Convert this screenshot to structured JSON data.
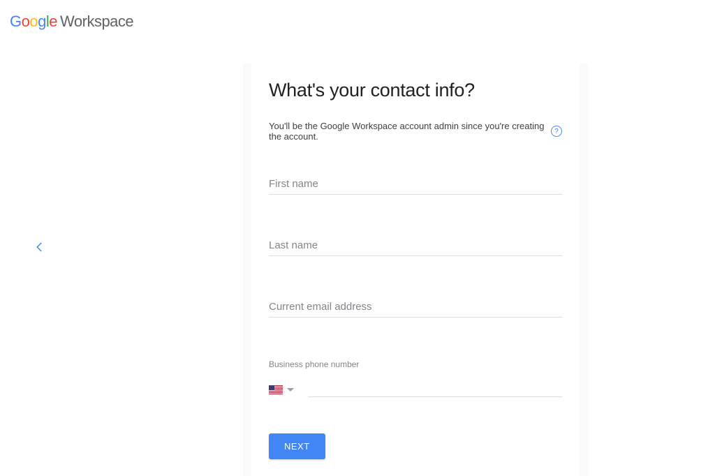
{
  "logo": {
    "brand": "Google",
    "product": "Workspace"
  },
  "form": {
    "heading": "What's your contact info?",
    "subtext": "You'll be the Google Workspace account admin since you're creating the account.",
    "help_symbol": "?",
    "first_name_placeholder": "First name",
    "last_name_placeholder": "Last name",
    "email_placeholder": "Current email address",
    "phone_label": "Business phone number",
    "country_flag": "us",
    "next_label": "NEXT"
  }
}
